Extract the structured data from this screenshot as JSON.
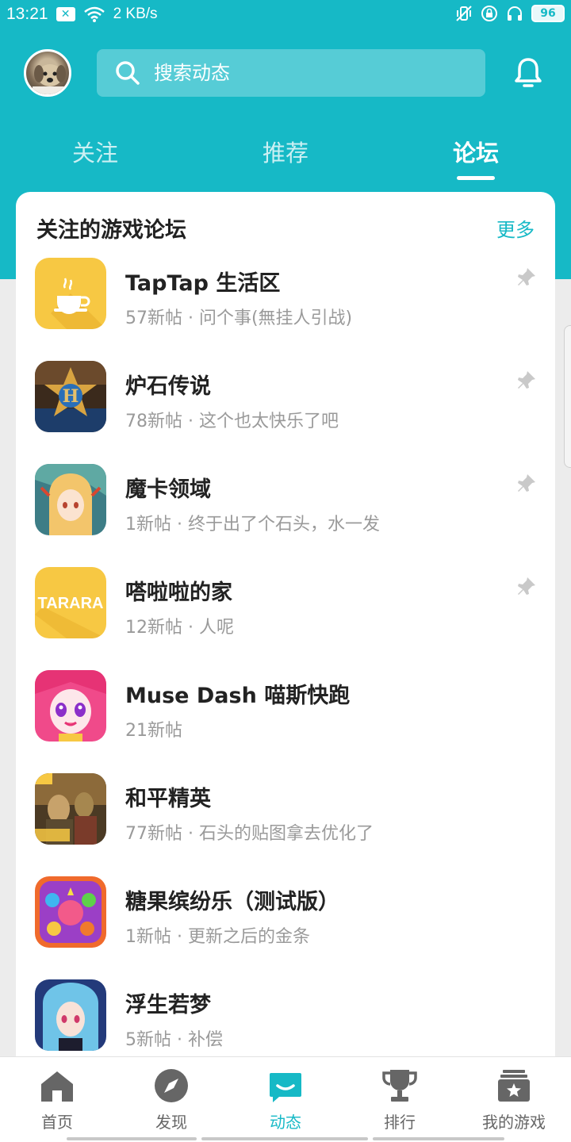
{
  "status": {
    "time": "13:21",
    "speed": "2 KB/s",
    "battery": "96"
  },
  "header": {
    "search_placeholder": "搜索动态"
  },
  "tabs": [
    {
      "label": "关注"
    },
    {
      "label": "推荐"
    },
    {
      "label": "论坛",
      "active": true
    }
  ],
  "section": {
    "title": "关注的游戏论坛",
    "more": "更多"
  },
  "forums": [
    {
      "name": "TapTap 生活区",
      "meta": "57新帖 · 问个事(無挂人引战)",
      "pinned": true,
      "icon": "coffee-cup-icon"
    },
    {
      "name": "炉石传说",
      "meta": "78新帖 · 这个也太快乐了吧",
      "pinned": true,
      "icon": "hearthstone-icon"
    },
    {
      "name": "魔卡领域",
      "meta": "1新帖 · 终于出了个石头，水一发",
      "pinned": true,
      "icon": "anime-girl-icon"
    },
    {
      "name": "嗒啦啦的家",
      "meta": "12新帖 · 人呢",
      "pinned": true,
      "icon": "tarara-icon",
      "icon_text": "TARARA"
    },
    {
      "name": "Muse Dash 喵斯快跑",
      "meta": "21新帖",
      "pinned": false,
      "icon": "muse-dash-icon"
    },
    {
      "name": "和平精英",
      "meta": "77新帖 · 石头的贴图拿去优化了",
      "pinned": false,
      "icon": "peace-elite-icon"
    },
    {
      "name": "糖果缤纷乐（测试版）",
      "meta": "1新帖 · 更新之后的金条",
      "pinned": false,
      "icon": "candy-icon"
    },
    {
      "name": "浮生若梦",
      "meta": "5新帖 · 补偿",
      "pinned": false,
      "icon": "anime-blue-icon"
    }
  ],
  "nav": [
    {
      "label": "首页",
      "icon": "home-icon"
    },
    {
      "label": "发现",
      "icon": "compass-icon"
    },
    {
      "label": "动态",
      "icon": "chat-icon",
      "active": true
    },
    {
      "label": "排行",
      "icon": "trophy-icon"
    },
    {
      "label": "我的游戏",
      "icon": "game-box-icon"
    }
  ],
  "colors": {
    "accent": "#16b9c6",
    "nav_inactive": "#666666"
  }
}
